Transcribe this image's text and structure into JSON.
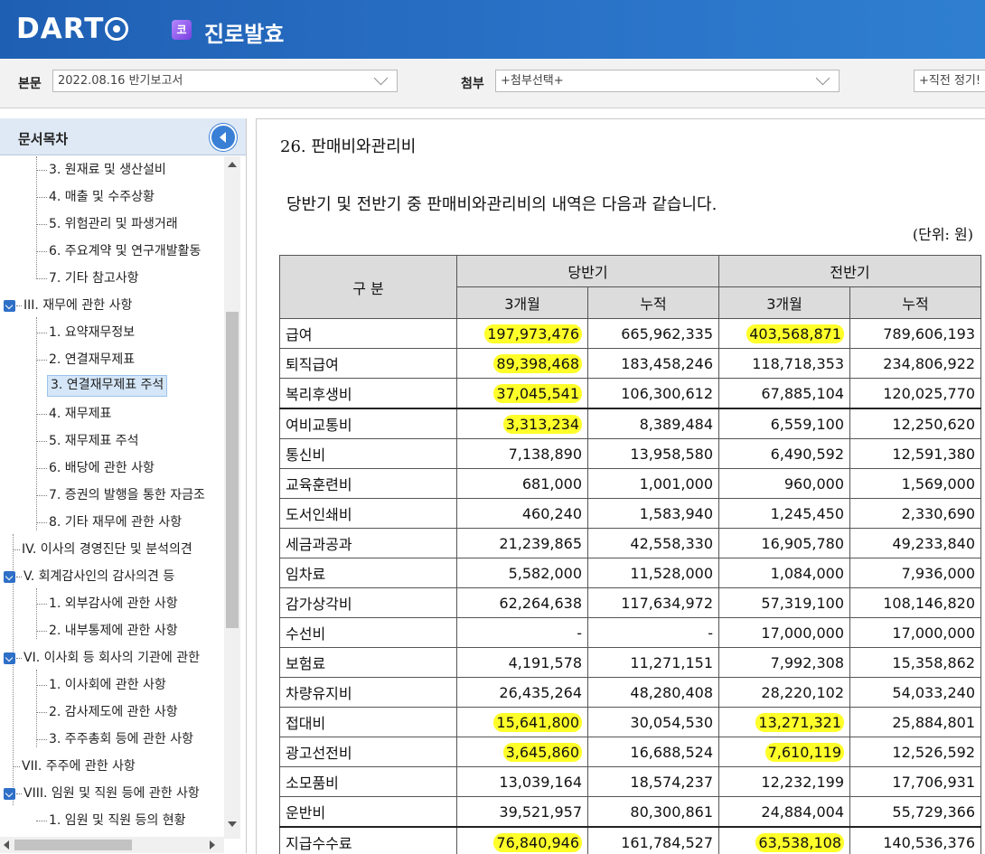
{
  "header": {
    "logo_text": "DART",
    "corp_badge": "코",
    "corp_name": "진로발효"
  },
  "toolbar": {
    "body_label": "본문",
    "body_select": "2022.08.16  반기보고서",
    "attach_label": "첨부",
    "attach_select": "+첨부선택+",
    "recent_select": "+직전 정기!"
  },
  "sidebar": {
    "title": "문서목차",
    "items": [
      "3. 원재료 및 생산설비",
      "4. 매출 및 수주상황",
      "5. 위험관리 및 파생거래",
      "6. 주요계약 및 연구개발활동",
      "7. 기타 참고사항",
      "III. 재무에 관한 사항",
      "1. 요약재무정보",
      "2. 연결재무제표",
      "3. 연결재무제표 주석",
      "4. 재무제표",
      "5. 재무제표 주석",
      "6. 배당에 관한 사항",
      "7. 증권의 발행을 통한 자금조",
      "8. 기타 재무에 관한 사항",
      "IV. 이사의 경영진단 및 분석의견",
      "V. 회계감사인의 감사의견 등",
      "1. 외부감사에 관한 사항",
      "2. 내부통제에 관한 사항",
      "VI. 이사회 등 회사의 기관에 관한",
      "1. 이사회에 관한 사항",
      "2. 감사제도에 관한 사항",
      "3. 주주총회 등에 관한 사항",
      "VII. 주주에 관한 사항",
      "VIII. 임원 및 직원 등에 관한 사항",
      "1. 임원 및 직원 등의 현황"
    ]
  },
  "document": {
    "title": "26. 판매비와관리비",
    "intro": "당반기 및 전반기 중 판매비와관리비의 내역은 다음과 같습니다.",
    "unit": "(단위: 원)",
    "head": {
      "category": "구 분",
      "current": "당반기",
      "previous": "전반기",
      "three_month": "3개월",
      "cumulative": "누적"
    },
    "rows": [
      {
        "name": "급여",
        "c3": "197,973,476",
        "cc": "665,962,335",
        "p3": "403,568,871",
        "pc": "789,606,193"
      },
      {
        "name": "퇴직급여",
        "c3": "89,398,468",
        "cc": "183,458,246",
        "p3": "118,718,353",
        "pc": "234,806,922"
      },
      {
        "name": "복리후생비",
        "c3": "37,045,541",
        "cc": "106,300,612",
        "p3": "67,885,104",
        "pc": "120,025,770"
      },
      {
        "name": "여비교통비",
        "c3": "3,313,234",
        "cc": "8,389,484",
        "p3": "6,559,100",
        "pc": "12,250,620"
      },
      {
        "name": "통신비",
        "c3": "7,138,890",
        "cc": "13,958,580",
        "p3": "6,490,592",
        "pc": "12,591,380"
      },
      {
        "name": "교육훈련비",
        "c3": "681,000",
        "cc": "1,001,000",
        "p3": "960,000",
        "pc": "1,569,000"
      },
      {
        "name": "도서인쇄비",
        "c3": "460,240",
        "cc": "1,583,940",
        "p3": "1,245,450",
        "pc": "2,330,690"
      },
      {
        "name": "세금과공과",
        "c3": "21,239,865",
        "cc": "42,558,330",
        "p3": "16,905,780",
        "pc": "49,233,840"
      },
      {
        "name": "임차료",
        "c3": "5,582,000",
        "cc": "11,528,000",
        "p3": "1,084,000",
        "pc": "7,936,000"
      },
      {
        "name": "감가상각비",
        "c3": "62,264,638",
        "cc": "117,634,972",
        "p3": "57,319,100",
        "pc": "108,146,820"
      },
      {
        "name": "수선비",
        "c3": "-",
        "cc": "-",
        "p3": "17,000,000",
        "pc": "17,000,000"
      },
      {
        "name": "보험료",
        "c3": "4,191,578",
        "cc": "11,271,151",
        "p3": "7,992,308",
        "pc": "15,358,862"
      },
      {
        "name": "차량유지비",
        "c3": "26,435,264",
        "cc": "48,280,408",
        "p3": "28,220,102",
        "pc": "54,033,240"
      },
      {
        "name": "접대비",
        "c3": "15,641,800",
        "cc": "30,054,530",
        "p3": "13,271,321",
        "pc": "25,884,801"
      },
      {
        "name": "광고선전비",
        "c3": "3,645,860",
        "cc": "16,688,524",
        "p3": "7,610,119",
        "pc": "12,526,592"
      },
      {
        "name": "소모품비",
        "c3": "13,039,164",
        "cc": "18,574,237",
        "p3": "12,232,199",
        "pc": "17,706,931"
      },
      {
        "name": "운반비",
        "c3": "39,521,957",
        "cc": "80,300,861",
        "p3": "24,884,004",
        "pc": "55,729,366"
      },
      {
        "name": "지급수수료",
        "c3": "76,840,946",
        "cc": "161,784,527",
        "p3": "63,538,108",
        "pc": "140,536,376"
      }
    ]
  }
}
